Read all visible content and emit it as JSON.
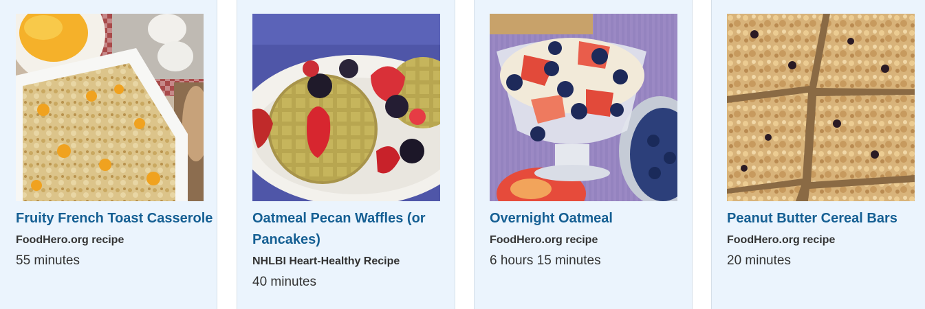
{
  "recipes": [
    {
      "title": "Fruity French Toast Casserole",
      "source": "FoodHero.org recipe",
      "time": "55 minutes",
      "image_icon": "french-toast-casserole-photo"
    },
    {
      "title": "Oatmeal Pecan Waffles (or Pancakes)",
      "source": "NHLBI Heart-Healthy Recipe",
      "time": "40 minutes",
      "image_icon": "waffles-with-berries-photo"
    },
    {
      "title": "Overnight Oatmeal",
      "source": "FoodHero.org recipe",
      "time": "6 hours 15 minutes",
      "image_icon": "overnight-oatmeal-photo"
    },
    {
      "title": "Peanut Butter Cereal Bars",
      "source": "FoodHero.org recipe",
      "time": "20 minutes",
      "image_icon": "cereal-bars-photo"
    }
  ],
  "colors": {
    "card_background": "#ebf4fd",
    "card_border": "#d5dfe9",
    "title_link": "#155f93",
    "body_text": "#333333"
  }
}
